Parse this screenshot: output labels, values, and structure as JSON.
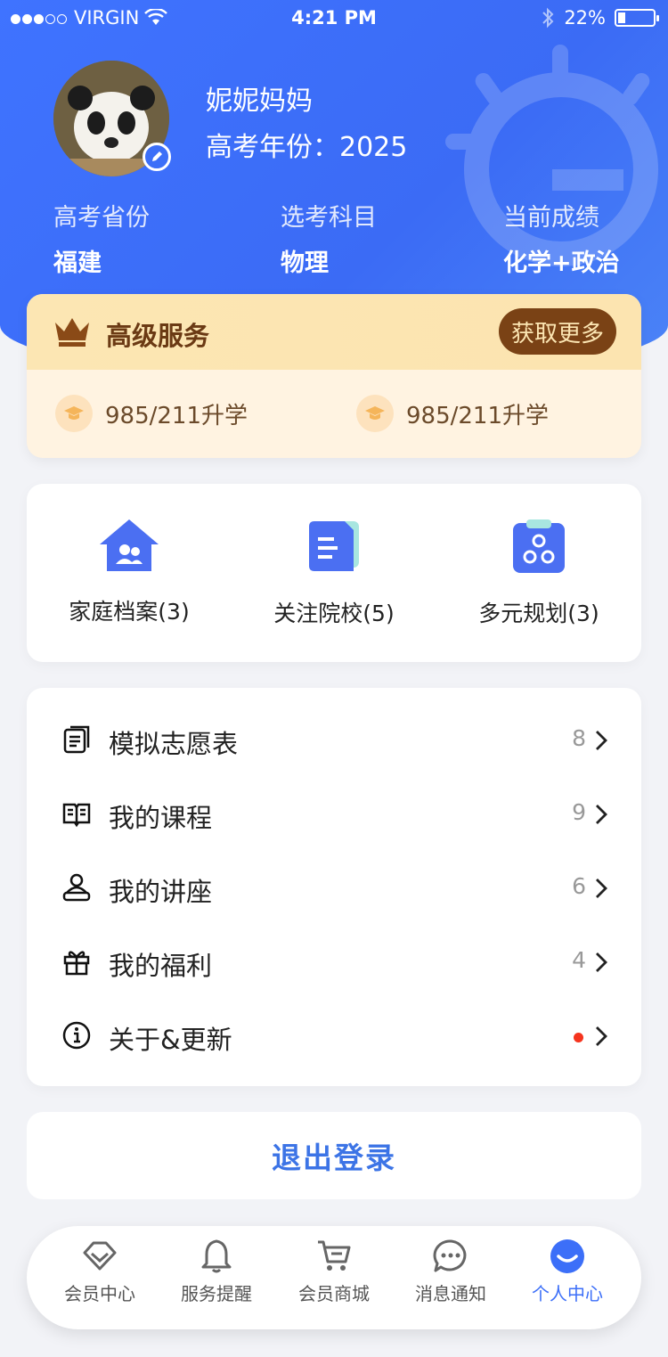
{
  "status_bar": {
    "carrier": "VIRGIN",
    "time": "4:21 PM",
    "battery": "22%",
    "battery_level": 0.22
  },
  "profile": {
    "name": "妮妮妈妈",
    "year_text": "高考年份：2025",
    "info": [
      {
        "label": "高考省份",
        "value": "福建"
      },
      {
        "label": "选考科目",
        "value": "物理"
      },
      {
        "label": "当前成绩",
        "value": "化学+政治"
      }
    ]
  },
  "premium": {
    "title": "高级服务",
    "button": "获取更多",
    "perks": [
      "985/211升学",
      "985/211升学"
    ]
  },
  "shortcuts": [
    {
      "label": "家庭档案(3)",
      "icon": "family-home-icon"
    },
    {
      "label": "关注院校(5)",
      "icon": "school-document-icon"
    },
    {
      "label": "多元规划(3)",
      "icon": "planning-clipboard-icon"
    }
  ],
  "menu": [
    {
      "label": "模拟志愿表",
      "count": "8",
      "icon": "document-list-icon"
    },
    {
      "label": "我的课程",
      "count": "9",
      "icon": "book-icon"
    },
    {
      "label": "我的讲座",
      "count": "6",
      "icon": "lecture-icon"
    },
    {
      "label": "我的福利",
      "count": "4",
      "icon": "gift-icon"
    },
    {
      "label": "关于&更新",
      "count": "",
      "icon": "info-icon"
    }
  ],
  "logout": "退出登录",
  "tabs": [
    {
      "label": "会员中心",
      "icon": "diamond-icon"
    },
    {
      "label": "服务提醒",
      "icon": "bell-icon"
    },
    {
      "label": "会员商城",
      "icon": "cart-icon"
    },
    {
      "label": "消息通知",
      "icon": "chat-icon"
    },
    {
      "label": "个人中心",
      "icon": "smile-icon",
      "active": true
    }
  ],
  "colors": {
    "primary": "#3C6FF8",
    "premium_brown": "#7A4215",
    "premium_gold": "#FCE6B3",
    "dot": "#F5341E"
  }
}
